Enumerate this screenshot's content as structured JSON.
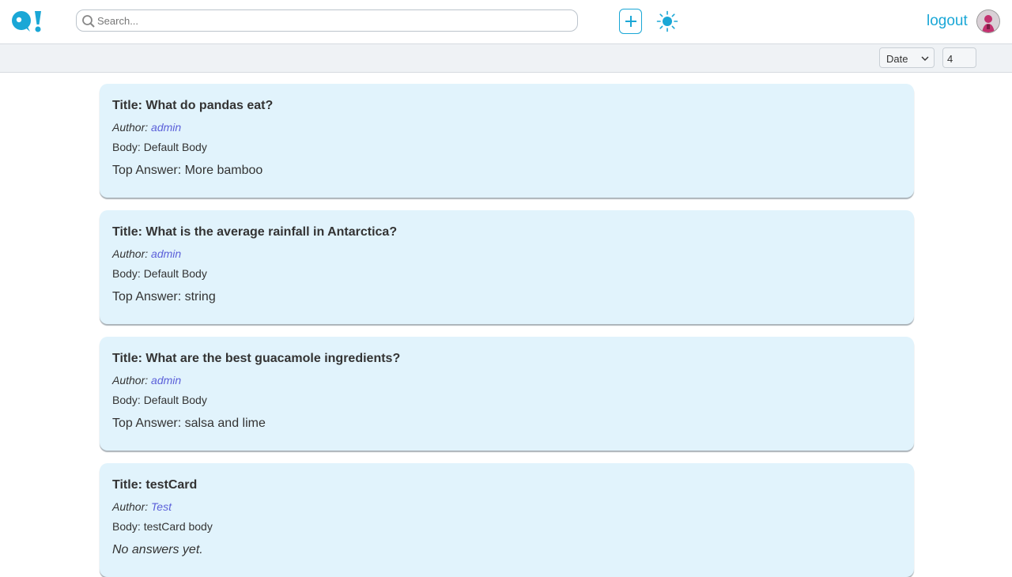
{
  "header": {
    "search_placeholder": "Search...",
    "logout_label": "logout",
    "accent_color": "#1aa7d6"
  },
  "filters": {
    "sort_value": "Date",
    "limit_value": "4"
  },
  "questions": [
    {
      "title": "Title: What do pandas eat?",
      "author_label": "Author:",
      "author_name": "admin",
      "body": "Body: Default Body",
      "answer": "Top Answer: More bamboo"
    },
    {
      "title": "Title: What is the average rainfall in Antarctica?",
      "author_label": "Author:",
      "author_name": "admin",
      "body": "Body: Default Body",
      "answer": "Top Answer: string"
    },
    {
      "title": "Title: What are the best guacamole ingredients?",
      "author_label": "Author:",
      "author_name": "admin",
      "body": "Body: Default Body",
      "answer": "Top Answer: salsa and lime"
    },
    {
      "title": "Title: testCard",
      "author_label": "Author:",
      "author_name": "Test",
      "body": "Body: testCard body",
      "answer": "No answers yet."
    }
  ]
}
